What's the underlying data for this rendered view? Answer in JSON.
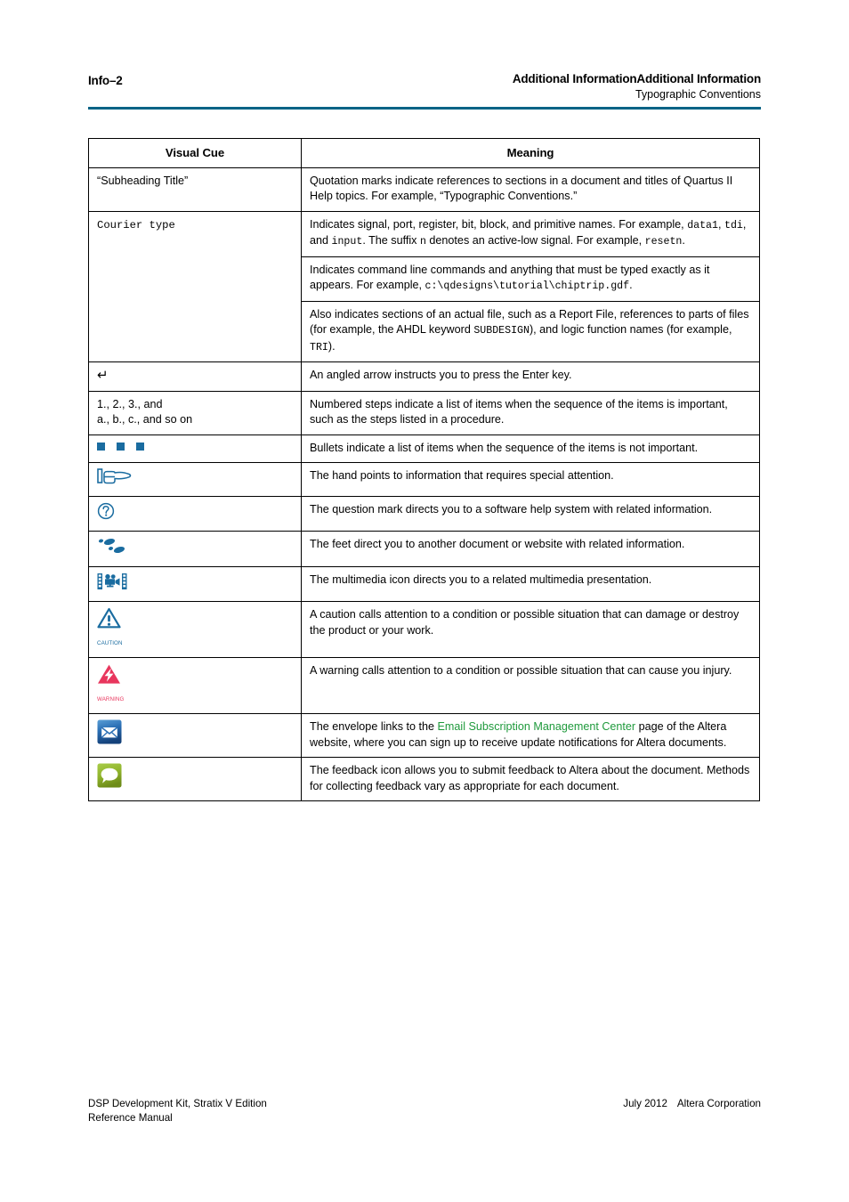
{
  "header": {
    "page_number": "Info–2",
    "section_title": "Additional InformationAdditional Information",
    "subsection_title": "Typographic Conventions",
    "rule_color": "#006385"
  },
  "table": {
    "columns": [
      "Visual Cue",
      "Meaning"
    ],
    "rows": [
      {
        "cue_text": "“Subheading Title”",
        "cue_type": "text",
        "meaning": "Quotation marks indicate references to sections in a document and titles of Quartus II Help topics. For example, “Typographic Conventions.”"
      },
      {
        "cue_text": "Courier type",
        "cue_type": "mono-text",
        "meaning_parts": [
          {
            "segments": [
              {
                "t": "Indicates signal, port, register, bit, block, and primitive names. For example, ",
                "style": "normal"
              },
              {
                "t": "data1",
                "style": "mono"
              },
              {
                "t": ", ",
                "style": "normal"
              },
              {
                "t": "tdi",
                "style": "mono"
              },
              {
                "t": ", and ",
                "style": "normal"
              },
              {
                "t": "input",
                "style": "mono"
              },
              {
                "t": ". The suffix ",
                "style": "normal"
              },
              {
                "t": "n",
                "style": "mono"
              },
              {
                "t": " denotes an active-low signal. For example, ",
                "style": "normal"
              },
              {
                "t": "resetn",
                "style": "mono"
              },
              {
                "t": ".",
                "style": "normal"
              }
            ]
          },
          {
            "segments": [
              {
                "t": "Indicates command line commands and anything that must be typed exactly as it appears. For example, ",
                "style": "normal"
              },
              {
                "t": "c:\\qdesigns\\tutorial\\chiptrip.gdf",
                "style": "mono"
              },
              {
                "t": ".",
                "style": "normal"
              }
            ]
          },
          {
            "segments": [
              {
                "t": "Also indicates sections of an actual file, such as a Report File, references to parts of files (for example, the AHDL keyword ",
                "style": "normal"
              },
              {
                "t": "SUBDESIGN",
                "style": "mono"
              },
              {
                "t": "), and logic function names (for example, ",
                "style": "normal"
              },
              {
                "t": "TRI",
                "style": "mono"
              },
              {
                "t": ").",
                "style": "normal"
              }
            ]
          }
        ]
      },
      {
        "cue_text": "↵",
        "cue_type": "glyph",
        "meaning": "An angled arrow instructs you to press the Enter key."
      },
      {
        "cue_text": "1., 2., 3., and\na., b., c., and so on",
        "cue_type": "text-multiline",
        "meaning": "Numbered steps indicate a list of items when the sequence of the items is important, such as the steps listed in a procedure."
      },
      {
        "cue_text": "",
        "cue_type": "bullets",
        "meaning": "Bullets indicate a list of items when the sequence of the items is not important."
      },
      {
        "cue_text": "",
        "cue_type": "hand-icon",
        "meaning": "The hand points to information that requires special attention."
      },
      {
        "cue_text": "",
        "cue_type": "question-icon",
        "meaning": "The question mark directs you to a software help system with related information."
      },
      {
        "cue_text": "",
        "cue_type": "feet-icon",
        "meaning": "The feet direct you to another document or website with related information."
      },
      {
        "cue_text": "",
        "cue_type": "multimedia-icon",
        "meaning": "The multimedia icon directs you to a related multimedia presentation."
      },
      {
        "cue_text": "CAUTION",
        "cue_type": "caution-icon",
        "meaning": "A caution calls attention to a condition or possible situation that can damage or destroy the product or your work."
      },
      {
        "cue_text": "WARNING",
        "cue_type": "warning-icon",
        "meaning": "A warning calls attention to a condition or possible situation that can cause you injury."
      },
      {
        "cue_text": "",
        "cue_type": "envelope-icon",
        "meaning_parts_inline": [
          {
            "t": "The envelope links to the ",
            "style": "normal"
          },
          {
            "t": "Email Subscription Management Center",
            "style": "link"
          },
          {
            "t": " page of the Altera website, where you can sign up to receive update notifications for Altera documents.",
            "style": "normal"
          }
        ]
      },
      {
        "cue_text": "",
        "cue_type": "feedback-icon",
        "meaning": "The feedback icon allows you to submit feedback to Altera about the document. Methods for collecting feedback vary as appropriate for each document."
      }
    ]
  },
  "footer": {
    "left_line1": "DSP Development Kit, Stratix V Edition",
    "left_line2": "Reference Manual",
    "right_date": "July 2012",
    "right_company": "Altera Corporation"
  },
  "colors": {
    "rule": "#006385",
    "icon_blue": "#1a6ca0",
    "warning_red": "#e8365d",
    "link_green": "#1f9a3c",
    "bullet_blue": "#1a6ca0"
  }
}
